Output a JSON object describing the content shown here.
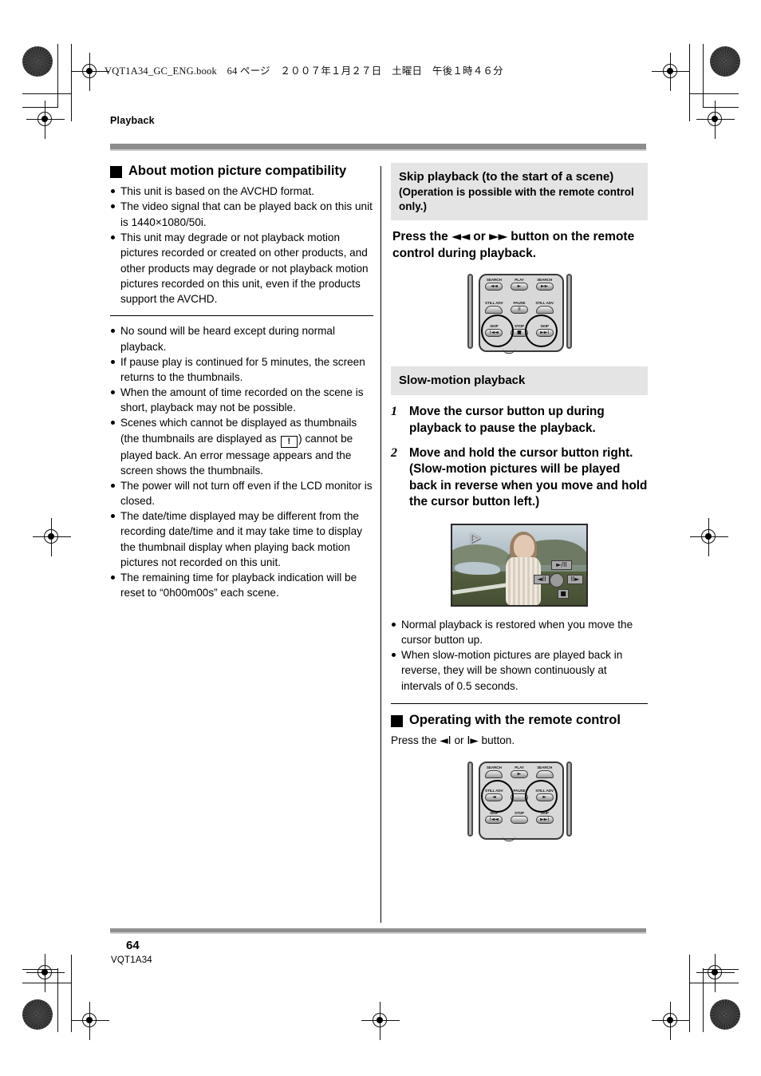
{
  "page": {
    "book_header": "VQT1A34_GC_ENG.book　64 ページ　２００７年１月２７日　土曜日　午後１時４６分",
    "running_head": "Playback",
    "page_number": "64",
    "doc_code": "VQT1A34"
  },
  "left_column": {
    "heading": "About motion picture compatibility",
    "bullets_top": [
      "This unit is based on the AVCHD format.",
      "The video signal that can be played back on this unit is 1440×1080/50i.",
      "This unit may degrade or not playback motion pictures recorded or created on other products, and other products may degrade or not playback motion pictures recorded on this unit, even if the products support the AVCHD."
    ],
    "bullets_bottom": [
      "No sound will be heard except during normal playback.",
      "If pause play is continued for 5 minutes, the screen returns to the thumbnails.",
      "When the amount of time recorded on the scene is short, playback may not be possible.",
      "The power will not turn off even if the LCD monitor is closed.",
      "The date/time displayed may be different from the recording date/time and it may take time to display the thumbnail display when playing back motion pictures not recorded on this unit.",
      "The remaining time for playback indication will be reset to “0h00m00s” each scene."
    ],
    "thumbnail_bullet": {
      "part1": "Scenes which cannot be displayed as thumbnails (the thumbnails are displayed as",
      "icon": "!",
      "part2": ") cannot be played back. An error message appears and the screen shows the thumbnails."
    }
  },
  "right_column": {
    "skip_section": {
      "title": "Skip playback (to the start of a scene)",
      "subtitle": "(Operation is possible with the remote control only.)",
      "instruction_pre": "Press the ",
      "instruction_glyph1": "◄◄",
      "instruction_mid": " or ",
      "instruction_glyph2": "►►",
      "instruction_post": " button on the remote control during playback."
    },
    "slow_section": {
      "title": "Slow-motion playback",
      "steps": [
        {
          "num": "1",
          "text": "Move the cursor button up during playback to pause the playback."
        },
        {
          "num": "2",
          "text": "Move and hold the cursor button right. (Slow-motion pictures will be played back in reverse when you move and hold the cursor button left.)"
        }
      ],
      "bullets": [
        "Normal playback is restored when you move the cursor button up.",
        "When slow-motion pictures are played back in reverse, they will be shown continuously at intervals of 0.5 seconds."
      ]
    },
    "remote_section": {
      "heading": "Operating with the remote control",
      "press_pre": "Press the ",
      "press_glyph1": "◄I",
      "press_mid": " or ",
      "press_glyph2": "I►",
      "press_post": " button."
    }
  },
  "remote_control": {
    "labels": {
      "search_left": "SEARCH",
      "play": "PLAY",
      "search_right": "SEARCH",
      "still_adv_left": "STILL ADV",
      "pause": "PAUSE",
      "still_adv_right": "STILL ADV",
      "skip_left": "SKIP",
      "stop": "STOP",
      "skip_right": "SKIP"
    },
    "glyphs": {
      "search_left": "◄◄",
      "play": "►",
      "search_right": "►►",
      "still_adv_left": "◄",
      "pause": "II",
      "still_adv_right": "►",
      "skip_left": "I◄◄",
      "stop": "■",
      "skip_right": "►►I"
    },
    "highlight_top": "skip-buttons",
    "highlight_bottom": "still-adv-buttons"
  },
  "lcd_screen": {
    "slow_indicator": "▷",
    "op_buttons": {
      "up": "►/II",
      "left": "◄II",
      "right": "II►",
      "down": "■"
    }
  },
  "colors": {
    "rule_gray": "#8c8c8c",
    "heading_band": "#e4e4e4",
    "text": "#000000"
  }
}
